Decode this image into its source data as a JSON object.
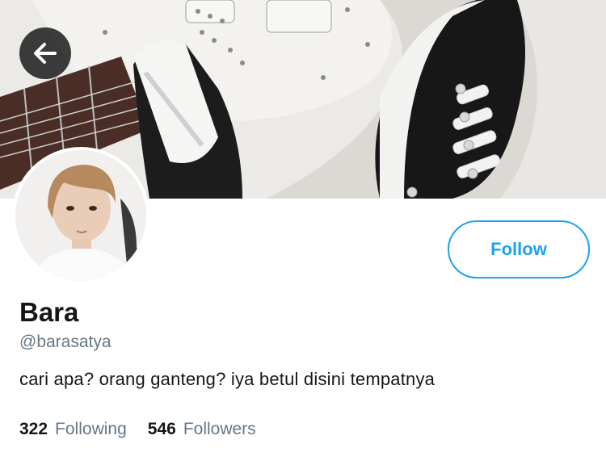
{
  "profile": {
    "name": "Bara",
    "handle": "@barasatya",
    "bio": "cari apa? orang ganteng? iya betul disini tempatnya",
    "following_count": "322",
    "following_label": "Following",
    "followers_count": "546",
    "followers_label": "Followers"
  },
  "actions": {
    "follow_label": "Follow",
    "back_icon": "arrow-left-icon"
  },
  "colors": {
    "accent": "#1da1f2",
    "text_primary": "#14171a",
    "text_secondary": "#657786"
  }
}
